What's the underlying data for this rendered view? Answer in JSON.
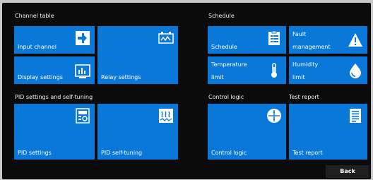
{
  "sections": {
    "channel_table": "Channel table",
    "schedule": "Schedule",
    "pid": "PID settings and self-tuning",
    "control_logic": "Control logic",
    "test_report": "Test report"
  },
  "tiles": {
    "input_channel": "Input channel",
    "relay_settings": "Relay settings",
    "display_settings": "Display settings",
    "schedule": "Schedule",
    "fault_management_1": "Fault",
    "fault_management_2": "management",
    "temperature_limit_1": "Temperature",
    "temperature_limit_2": "limit",
    "humidity_limit_1": "Humidity",
    "humidity_limit_2": "limit",
    "pid_settings": "PID settings",
    "pid_self_tuning": "PID self-tuning",
    "control_logic": "Control logic",
    "test_report": "Test report"
  },
  "back_label": "Back",
  "colors": {
    "tile": "#0a78d8",
    "background": "#0b0b0b"
  }
}
